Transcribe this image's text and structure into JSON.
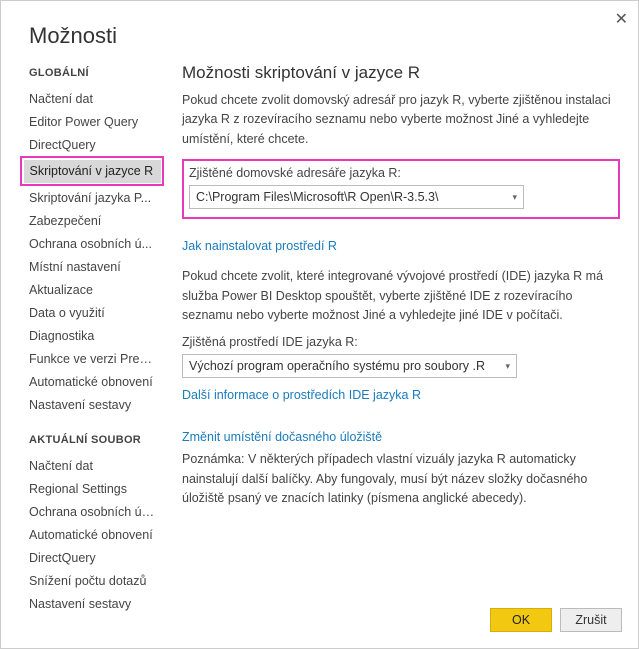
{
  "window": {
    "title": "Možnosti"
  },
  "sidebar": {
    "global_header": "GLOBÁLNÍ",
    "current_header": "AKTUÁLNÍ SOUBOR",
    "global": [
      "Načtení dat",
      "Editor Power Query",
      "DirectQuery",
      "Skriptování v jazyce R",
      "Skriptování jazyka P...",
      "Zabezpečení",
      "Ochrana osobních ú...",
      "Místní nastavení",
      "Aktualizace",
      "Data o využití",
      "Diagnostika",
      "Funkce ve verzi Preview",
      "Automatické obnovení",
      "Nastavení sestavy"
    ],
    "current": [
      "Načtení dat",
      "Regional Settings",
      "Ochrana osobních údajů",
      "Automatické obnovení",
      "DirectQuery",
      "Snížení počtu dotazů",
      "Nastavení sestavy"
    ]
  },
  "main": {
    "title": "Možnosti skriptování v jazyce R",
    "intro": "Pokud chcete zvolit domovský adresář pro jazyk R, vyberte zjištěnou instalaci jazyka R z rozevíracího seznamu nebo vyberte možnost Jiné a vyhledejte umístění, které chcete.",
    "home_label": "Zjištěné domovské adresáře jazyka R:",
    "home_value": "C:\\Program Files\\Microsoft\\R Open\\R-3.5.3\\",
    "install_link": "Jak nainstalovat prostředí R",
    "ide_intro": "Pokud chcete zvolit, které integrované vývojové prostředí (IDE) jazyka R má služba Power BI Desktop spouštět, vyberte zjištěné IDE z rozevíracího seznamu nebo vyberte možnost Jiné a vyhledejte jiné IDE v počítači.",
    "ide_label": "Zjištěná prostředí IDE jazyka R:",
    "ide_value": "Výchozí program operačního systému pro soubory .R",
    "ide_link": "Další informace o prostředích IDE jazyka R",
    "temp_link": "Změnit umístění dočasného úložiště",
    "note": "Poznámka: V některých případech vlastní vizuály jazyka R automaticky nainstalují další balíčky. Aby fungovaly, musí být název složky dočasného úložiště psaný ve znacích latinky (písmena anglické abecedy)."
  },
  "buttons": {
    "ok": "OK",
    "cancel": "Zrušit"
  }
}
